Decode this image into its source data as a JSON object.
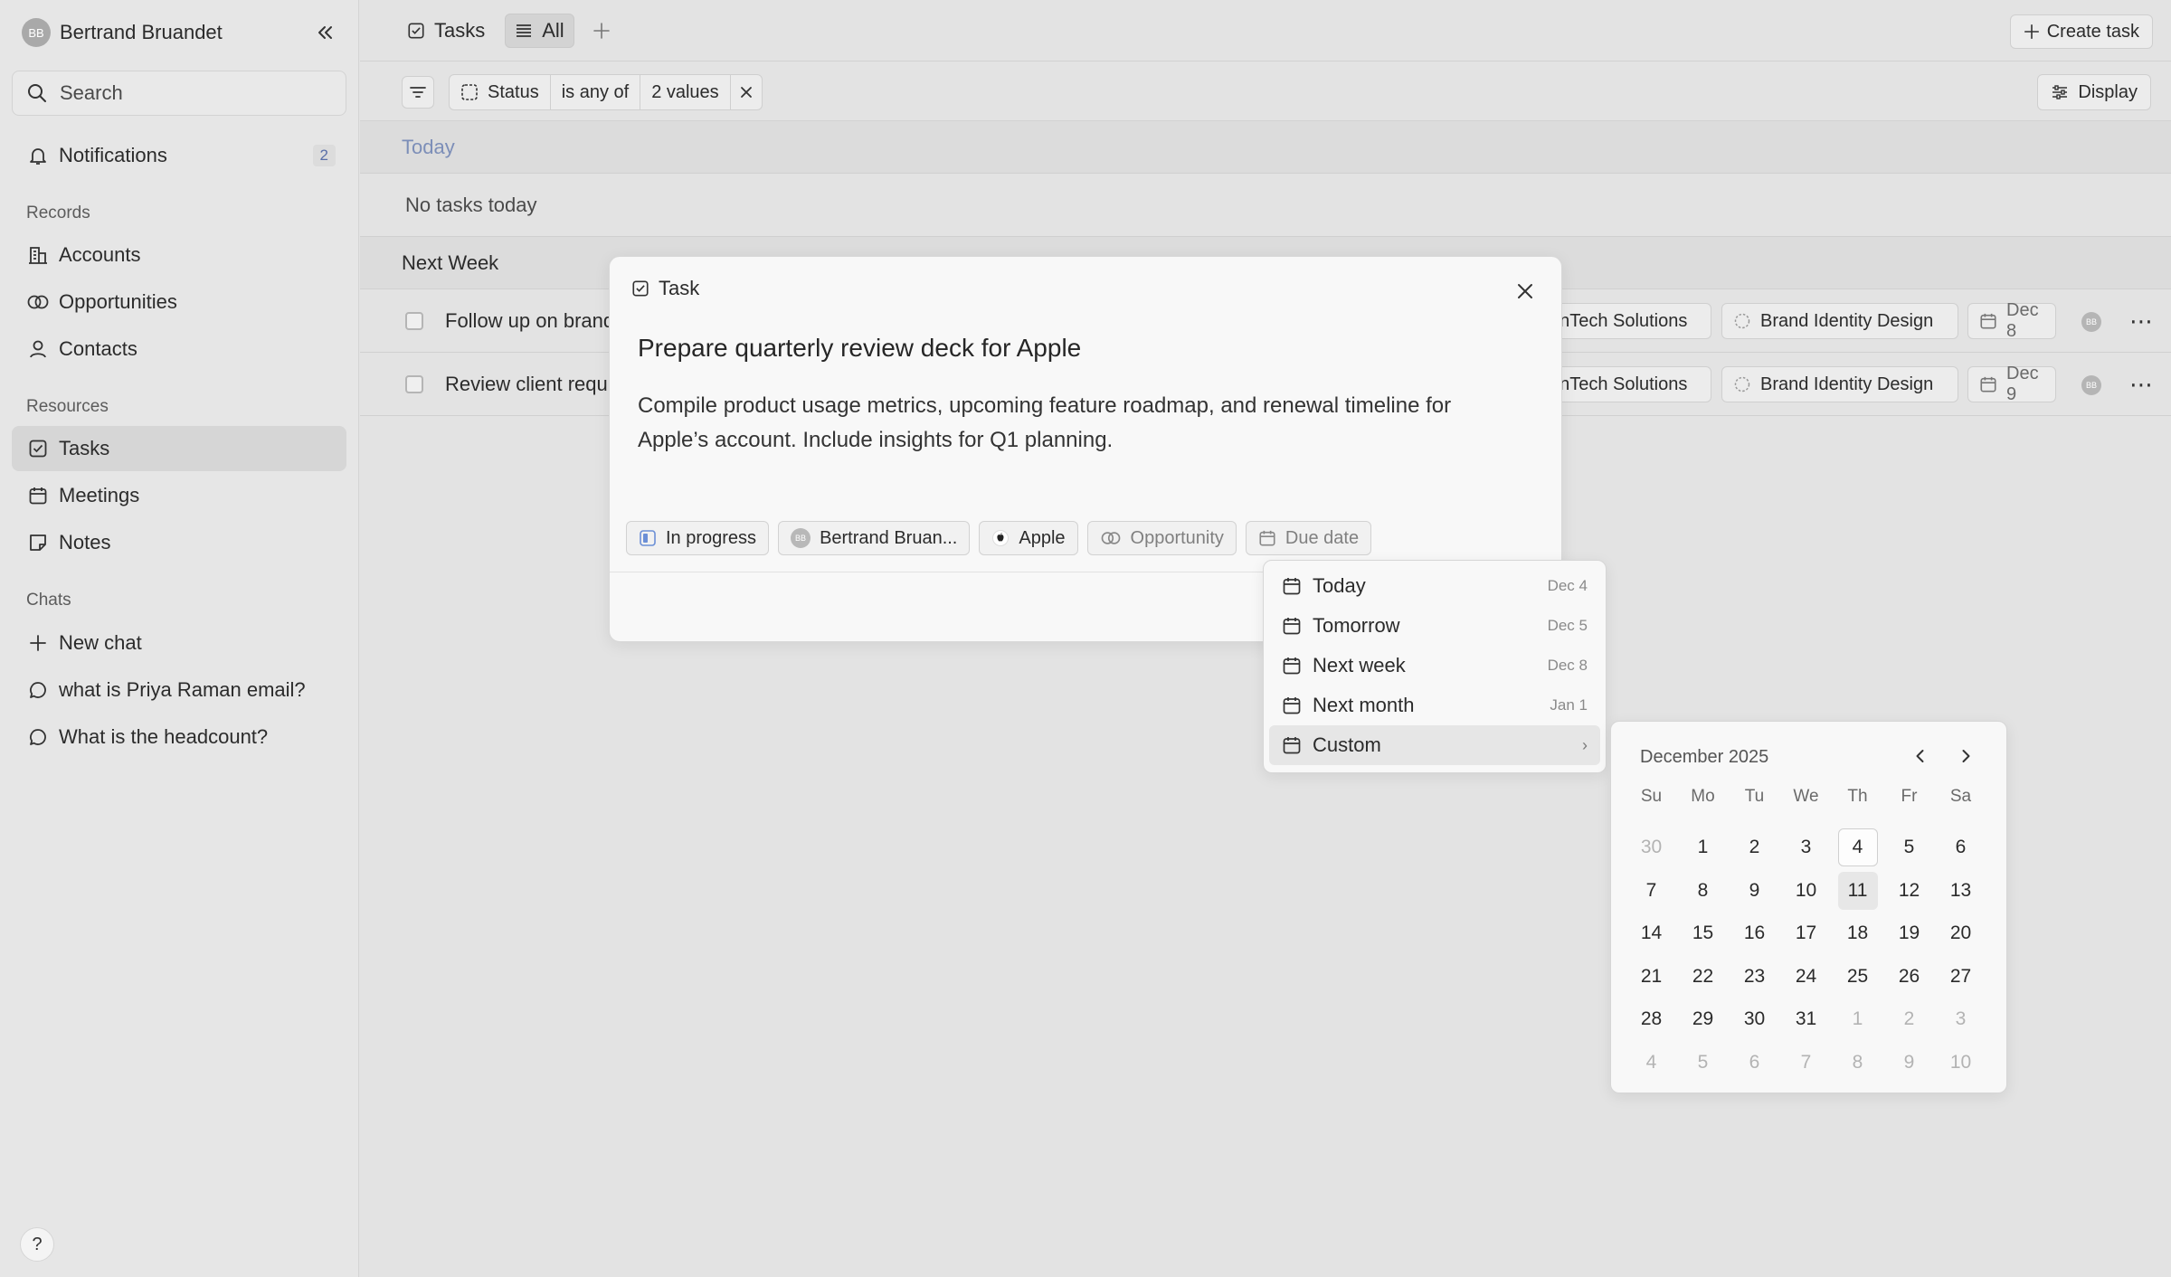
{
  "user": {
    "initials": "BB",
    "name": "Bertrand Bruandet"
  },
  "search": {
    "placeholder": "Search"
  },
  "notifications": {
    "label": "Notifications",
    "count": "2"
  },
  "sidebar": {
    "records_label": "Records",
    "records": [
      "Accounts",
      "Opportunities",
      "Contacts"
    ],
    "resources_label": "Resources",
    "resources": [
      "Tasks",
      "Meetings",
      "Notes"
    ],
    "chats_label": "Chats",
    "new_chat": "New chat",
    "chats": [
      "what is Priya Raman email?",
      "What is the headcount?"
    ],
    "help": "?"
  },
  "topbar": {
    "tasks_tab": "Tasks",
    "all_tab": "All",
    "create_task": "Create task"
  },
  "filter": {
    "field": "Status",
    "operator": "is any of",
    "value": "2 values",
    "display": "Display"
  },
  "groups": {
    "today": "Today",
    "today_empty": "No tasks today",
    "next_week": "Next Week"
  },
  "tasks": [
    {
      "title": "Follow up on brand",
      "company": "enTech Solutions",
      "opportunity": "Brand Identity Design",
      "due": "Dec 8",
      "assignee": "BB"
    },
    {
      "title": "Review client requ",
      "company": "enTech Solutions",
      "opportunity": "Brand Identity Design",
      "due": "Dec 9",
      "assignee": "BB"
    }
  ],
  "modal": {
    "header": "Task",
    "title": "Prepare quarterly review deck for Apple",
    "description": "Compile product usage metrics, upcoming feature roadmap, and renewal timeline for Apple’s account. Include insights for Q1 planning.",
    "status": "In progress",
    "assignee_initials": "BB",
    "assignee": "Bertrand Bruan...",
    "company": "Apple",
    "opportunity": "Opportunity",
    "due_date": "Due date"
  },
  "due_menu": [
    {
      "label": "Today",
      "date": "Dec 4"
    },
    {
      "label": "Tomorrow",
      "date": "Dec 5"
    },
    {
      "label": "Next week",
      "date": "Dec 8"
    },
    {
      "label": "Next month",
      "date": "Jan 1"
    },
    {
      "label": "Custom",
      "date": ""
    }
  ],
  "calendar": {
    "month": "December 2025",
    "weekdays": [
      "Su",
      "Mo",
      "Tu",
      "We",
      "Th",
      "Fr",
      "Sa"
    ],
    "today": "4",
    "selected": "11",
    "weeks": [
      [
        "30",
        "1",
        "2",
        "3",
        "4",
        "5",
        "6"
      ],
      [
        "7",
        "8",
        "9",
        "10",
        "11",
        "12",
        "13"
      ],
      [
        "14",
        "15",
        "16",
        "17",
        "18",
        "19",
        "20"
      ],
      [
        "21",
        "22",
        "23",
        "24",
        "25",
        "26",
        "27"
      ],
      [
        "28",
        "29",
        "30",
        "31",
        "1",
        "2",
        "3"
      ],
      [
        "4",
        "5",
        "6",
        "7",
        "8",
        "9",
        "10"
      ]
    ]
  },
  "colors": {
    "today_header": "#7c8eb8",
    "badge_text": "#5a6fa8",
    "status_icon": "#6b8fd6"
  }
}
